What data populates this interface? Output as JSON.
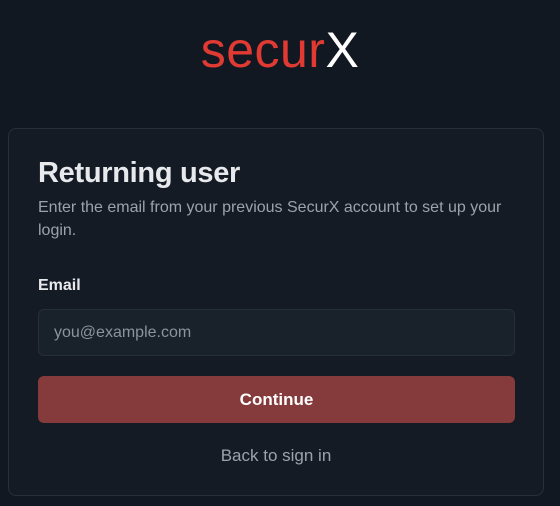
{
  "logo": {
    "part_a": "secur",
    "part_b": "X",
    "part_a_color": "#e03a33",
    "part_b_color": "#ffffff"
  },
  "card": {
    "title": "Returning user",
    "description": "Enter the email from your previous SecurX account to set up your login.",
    "email": {
      "label": "Email",
      "value": "",
      "placeholder": "you@example.com"
    },
    "continue_label": "Continue",
    "back_link_label": "Back to sign in"
  },
  "colors": {
    "background": "#121821",
    "card_background": "#151b24",
    "primary_button": "#853a3b"
  }
}
